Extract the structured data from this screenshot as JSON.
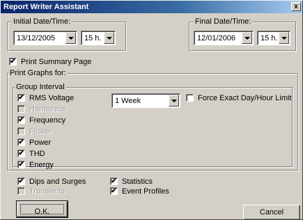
{
  "window": {
    "title": "Report Writer Assistant",
    "close_glyph": "x"
  },
  "initial": {
    "legend": "Initial Date/Time:",
    "date": "13/12/2005",
    "hour": "15 h."
  },
  "final": {
    "legend": "Final Date/Time:",
    "date": "12/01/2006",
    "hour": "15 h."
  },
  "summary": {
    "label": "Print Summary Page",
    "checked": true
  },
  "graphs": {
    "legend": "Print Graphs for:",
    "group_legend": "Group Interval",
    "interval": "1 Week",
    "force_label": "Force Exact Day/Hour Limit",
    "items": [
      {
        "label": "RMS Voltage",
        "checked": true,
        "enabled": true
      },
      {
        "label": "Harmonics",
        "checked": false,
        "enabled": false
      },
      {
        "label": "Frequency",
        "checked": true,
        "enabled": true
      },
      {
        "label": "Flicker",
        "checked": false,
        "enabled": false
      },
      {
        "label": "Power",
        "checked": true,
        "enabled": true
      },
      {
        "label": "THD",
        "checked": true,
        "enabled": true
      },
      {
        "label": "Energy",
        "checked": true,
        "enabled": true
      }
    ]
  },
  "events": {
    "dips": {
      "label": "Dips and Surges",
      "checked": true,
      "enabled": true
    },
    "transients": {
      "label": "Transients",
      "checked": false,
      "enabled": false
    },
    "statistics": {
      "label": "Statistics",
      "checked": true,
      "enabled": true
    },
    "event_profiles": {
      "label": "Event Profiles",
      "checked": true,
      "enabled": true
    }
  },
  "buttons": {
    "ok": "O.K.",
    "cancel": "Cancel"
  },
  "check_glyph": "✔"
}
